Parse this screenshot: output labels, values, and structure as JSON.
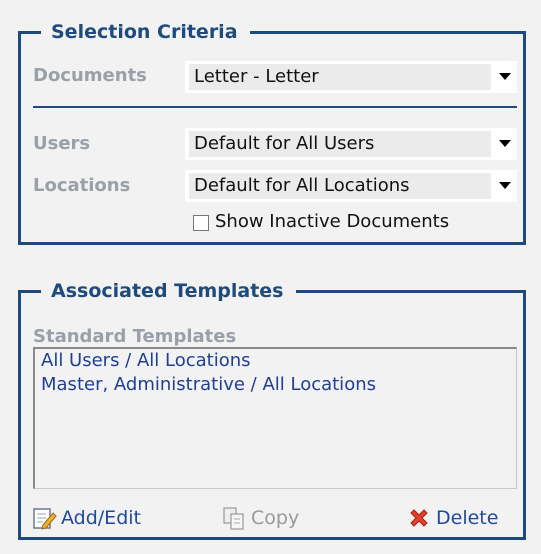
{
  "selection_criteria": {
    "legend": "Selection Criteria",
    "documents": {
      "label": "Documents",
      "value": "Letter - Letter"
    },
    "users": {
      "label": "Users",
      "value": "Default for All Users"
    },
    "locations": {
      "label": "Locations",
      "value": "Default for All Locations"
    },
    "show_inactive": {
      "label": "Show Inactive Documents",
      "checked": false
    }
  },
  "associated_templates": {
    "legend": "Associated Templates",
    "standard_label": "Standard Templates",
    "items": [
      "All Users / All Locations",
      "Master, Administrative / All Locations"
    ],
    "actions": {
      "add_edit": "Add/Edit",
      "copy": "Copy",
      "delete": "Delete"
    }
  },
  "colors": {
    "frame": "#1f4a7c",
    "label_gray": "#9aa0a8",
    "link_blue": "#1f4a9c",
    "delete_red": "#d93a2a"
  },
  "icons": [
    "edit-icon",
    "copy-icon",
    "delete-x-icon",
    "dropdown-arrow-icon"
  ]
}
